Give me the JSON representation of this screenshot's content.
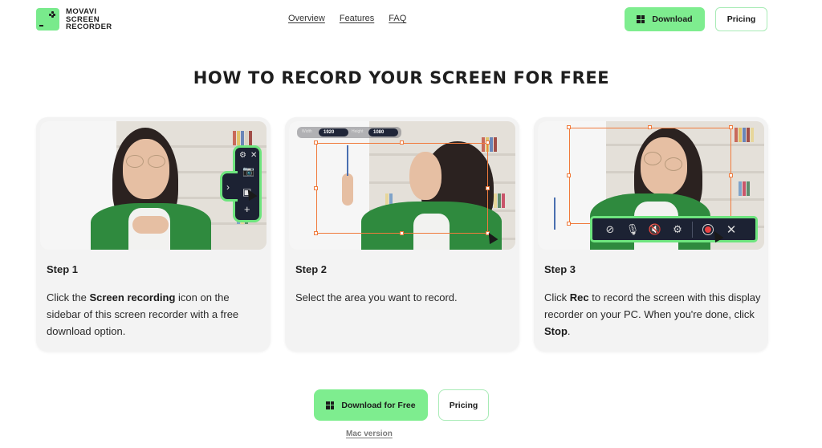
{
  "brand": {
    "name_lines": [
      "MOVAVI",
      "SCREEN",
      "RECORDER"
    ],
    "accent_color": "#7eed8f",
    "dark_widget_color": "#1c2233",
    "selection_color": "#f07a3c"
  },
  "nav": {
    "links": [
      "Overview",
      "Features",
      "FAQ"
    ]
  },
  "header_actions": {
    "download_label": "Download",
    "download_icon": "windows-icon",
    "pricing_label": "Pricing"
  },
  "page": {
    "title": "HOW TO RECORD YOUR SCREEN FOR FREE"
  },
  "steps": [
    {
      "label": "Step 1",
      "text_parts": [
        {
          "text": "Click the ",
          "bold": false
        },
        {
          "text": "Screen recording",
          "bold": true
        },
        {
          "text": " icon on the sidebar of this screen recorder with a free download option.",
          "bold": false
        }
      ],
      "image_widget": {
        "icons": [
          "gear-icon",
          "close-icon",
          "camera-icon",
          "chevron-right-icon",
          "screen-recording-icon",
          "plus-icon"
        ]
      }
    },
    {
      "label": "Step 2",
      "text_parts": [
        {
          "text": "Select the area you want to record.",
          "bold": false
        }
      ],
      "image_widget": {
        "width_label": "Width",
        "width_value": "1920",
        "height_label": "Height",
        "height_value": "1080"
      }
    },
    {
      "label": "Step 3",
      "text_parts": [
        {
          "text": "Click ",
          "bold": false
        },
        {
          "text": "Rec",
          "bold": true
        },
        {
          "text": " to record the screen with this display recorder on your PC. When you're done, click ",
          "bold": false
        },
        {
          "text": "Stop",
          "bold": true
        },
        {
          "text": ".",
          "bold": false
        }
      ],
      "image_widget": {
        "icons": [
          "webcam-off-icon",
          "microphone-off-icon",
          "speaker-off-icon",
          "gear-icon",
          "record-icon",
          "close-icon"
        ]
      }
    }
  ],
  "cta": {
    "download_label": "Download for Free",
    "pricing_label": "Pricing",
    "mac_link": "Mac version"
  }
}
